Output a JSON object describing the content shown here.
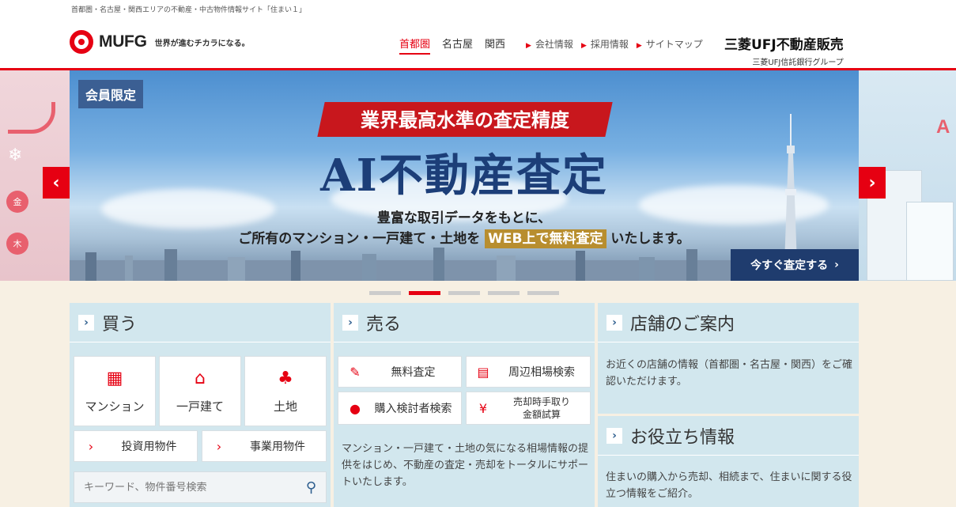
{
  "header": {
    "site_description": "首都圏・名古屋・関西エリアの不動産・中古物件情報サイト「住まい１」",
    "logo_text": "MUFG",
    "slogan": "世界が進むチカラになる。",
    "regions": [
      "首都圏",
      "名古屋",
      "関西"
    ],
    "active_region": "首都圏",
    "utility_links": [
      "会社情報",
      "採用情報",
      "サイトマップ"
    ],
    "brand_name": "三菱UFJ不動産販売",
    "brand_sub": "三菱UFJ信託銀行グループ"
  },
  "hero": {
    "badge": "会員限定",
    "ribbon": "業界最高水準の査定精度",
    "title": "AI不動産査定",
    "line1": "豊富な取引データをもとに、",
    "line2_pre": "ご所有のマンション・一戸建て・土地を",
    "line2_highlight": "WEB上で無料査定",
    "line2_post": "いたします。",
    "cta": "今すぐ査定する",
    "prev": "‹",
    "next": "›",
    "slide_count": 5,
    "active_slide": 2
  },
  "side_left": {
    "weekday1": "金",
    "weekday2": "木"
  },
  "side_right": {
    "letter": "A"
  },
  "buy": {
    "title": "買う",
    "tiles": [
      {
        "icon": "building-icon",
        "label": "マンション"
      },
      {
        "icon": "house-icon",
        "label": "一戸建て"
      },
      {
        "icon": "tree-icon",
        "label": "土地"
      }
    ],
    "links": [
      "投資用物件",
      "事業用物件"
    ],
    "search_placeholder": "キーワード、物件番号検索"
  },
  "sell": {
    "title": "売る",
    "tiles": [
      {
        "icon": "clipboard-icon",
        "label": "無料査定"
      },
      {
        "icon": "chart-icon",
        "label": "周辺相場検索"
      },
      {
        "icon": "person-icon",
        "label": "購入検討者検索"
      },
      {
        "icon": "yen-icon",
        "label_line1": "売却時手取り",
        "label_line2": "金額試算"
      }
    ],
    "description": "マンション・一戸建て・土地の気になる相場情報の提供をはじめ、不動産の査定・売却をトータルにサポートいたします。"
  },
  "stores": {
    "title": "店舗のご案内",
    "description": "お近くの店舗の情報（首都圏・名古屋・関西）をご確認いただけます。"
  },
  "info": {
    "title": "お役立ち情報",
    "description": "住まいの購入から売却、相続まで、住まいに関する役立つ情報をご紹介。"
  },
  "colors": {
    "accent": "#e60012",
    "navy": "#1f3c6e",
    "panel": "#d2e7ee",
    "gold": "#b88e2f"
  }
}
